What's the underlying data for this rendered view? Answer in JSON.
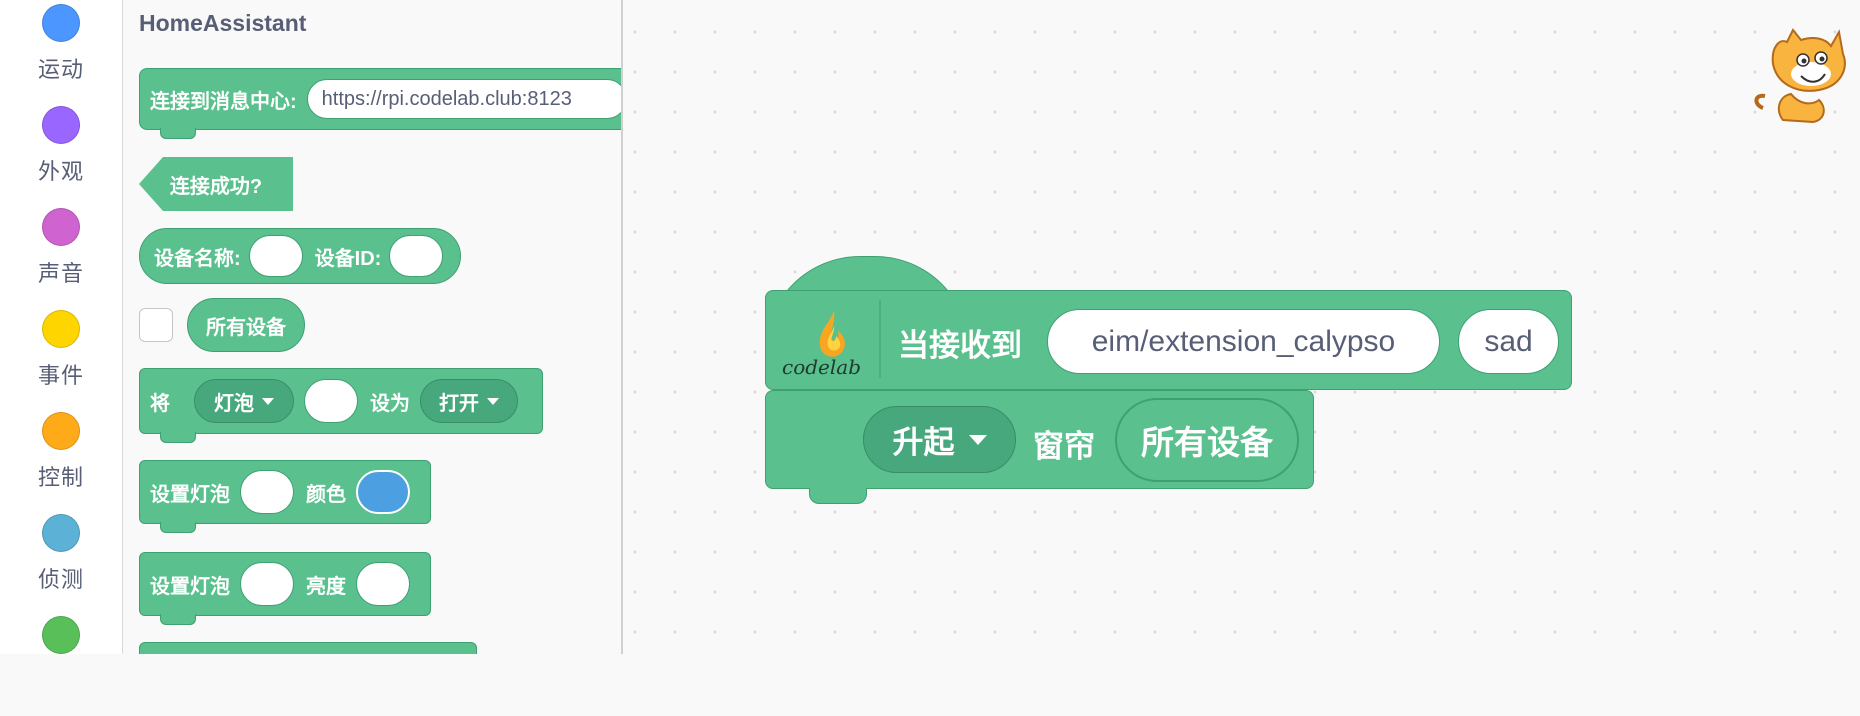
{
  "categories": [
    {
      "label": "运动",
      "color": "#4c97ff"
    },
    {
      "label": "外观",
      "color": "#9966ff"
    },
    {
      "label": "声音",
      "color": "#cf63cf"
    },
    {
      "label": "事件",
      "color": "#ffd500"
    },
    {
      "label": "控制",
      "color": "#ffab19"
    },
    {
      "label": "侦测",
      "color": "#5cb1d6"
    },
    {
      "label": "",
      "color": "#59c059"
    }
  ],
  "palette": {
    "title": "HomeAssistant",
    "connect": {
      "label": "连接到消息中心:",
      "url": "https://rpi.codelab.club:8123"
    },
    "connected": "连接成功?",
    "device": {
      "name_label": "设备名称:",
      "id_label": "设备ID:"
    },
    "all_devices": "所有设备",
    "set_device": {
      "prefix": "将",
      "device": "灯泡",
      "mid": "设为",
      "state": "打开"
    },
    "bulb_color": {
      "label": "设置灯泡",
      "prop": "颜色",
      "swatch": "#4c9fe0"
    },
    "bulb_brightness": {
      "label": "设置灯泡",
      "prop": "亮度"
    }
  },
  "workspace": {
    "hat": {
      "logo_text": "codelab",
      "label": "当接收到",
      "topic": "eim/extension_calypso",
      "message": "sad"
    },
    "command": {
      "action": "升起",
      "label": "窗帘",
      "target": "所有设备"
    }
  },
  "colors": {
    "block": "#59c08e",
    "block_border": "#3fa072",
    "dropdown": "#47a87d"
  }
}
